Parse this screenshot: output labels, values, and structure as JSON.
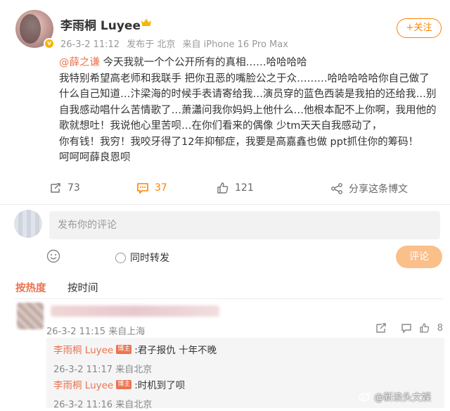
{
  "post": {
    "username": "李雨桐 Luyee",
    "meta_time": "26-3-2 11:12",
    "meta_posted": "发布于 北京",
    "meta_source": "来自 iPhone 16 Pro Max",
    "follow_label": "+关注",
    "body_mention": "@薛之谦",
    "body_lines": [
      " 今天我就一个个公开所有的真相……哈哈哈哈",
      "我特别希望高老师和我联手 把你丑恶的嘴脸公之于众………哈哈哈哈哈你自己做了",
      "什么自己知道…汴梁海的时候手表请寄给我…演员穿的蓝色西装是我拍的还给我…别",
      "自我感动唱什么苦情歌了…萧瀟问我你妈妈上他什么…他根本配不上你啊，我用他的",
      "歌就想吐！我说他心里苦呗…在你们看来的偶像 少tm天天自我感动了，",
      "你有钱！我穷！我咬牙得了12年抑郁症，我要是高嘉鑫也做 ppt抓住你的筹码！",
      "呵呵呵薛良恩呗"
    ]
  },
  "actions": {
    "forward_count": "73",
    "comment_count": "37",
    "like_count": "121",
    "share_label": "分享这条博文"
  },
  "comment_box": {
    "placeholder": "发布你的评论",
    "repost_label": "同时转发",
    "submit_label": "评论"
  },
  "sort_tabs": {
    "hot": "按热度",
    "time": "按时间"
  },
  "comment": {
    "meta": "26-3-2 11:15 来自上海",
    "like_count": "8",
    "replies": [
      {
        "name": "李雨桐 Luyee",
        "badge": "博主",
        "text": ":君子报仇 十年不晚",
        "meta": "26-3-2 11:17 来自北京"
      },
      {
        "name": "李雨桐 Luyee",
        "badge": "博主",
        "text": ":时机到了呗",
        "meta": "26-3-2 11:16 来自北京"
      }
    ]
  },
  "watermark": "@新浪头文娱",
  "colors": {
    "accent": "#ff8200",
    "link": "#eb7350",
    "muted": "#999999"
  }
}
